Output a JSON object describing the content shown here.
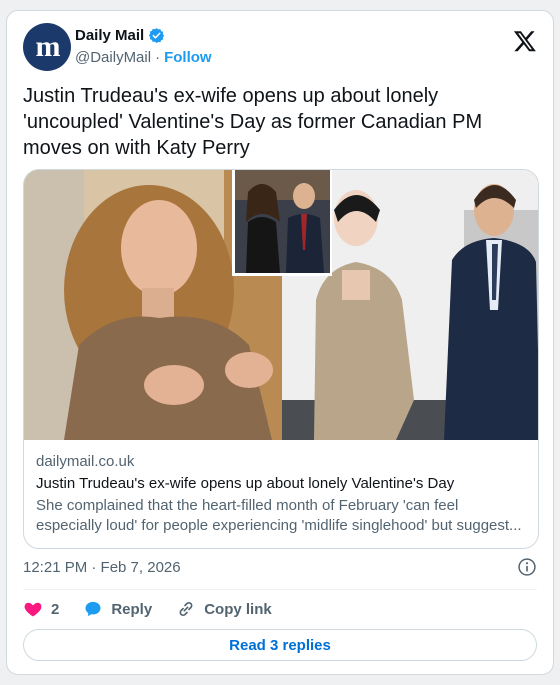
{
  "author": {
    "display_name": "Daily Mail",
    "handle": "@DailyMail",
    "separator": "·",
    "follow_label": "Follow",
    "avatar_text": "m",
    "verified": true
  },
  "tweet": {
    "text": "Justin Trudeau's ex-wife opens up about lonely 'uncoupled' Valentine's Day as former Canadian PM moves on with Katy Perry"
  },
  "link_card": {
    "domain": "dailymail.co.uk",
    "title": "Justin Trudeau's ex-wife opens up about lonely Valentine's Day",
    "description_line1": "She complained that the heart-filled month of February 'can feel",
    "description_line2": "especially loud' for people experiencing 'midlife singlehood' but suggest..."
  },
  "timestamp": "12:21 PM · Feb 7, 2026",
  "actions": {
    "like_count": "2",
    "reply_label": "Reply",
    "copy_link_label": "Copy link"
  },
  "read_replies_label": "Read 3 replies",
  "icons": {
    "verified": "verified-badge-icon",
    "brand": "x-logo-icon",
    "info": "info-icon",
    "like": "heart-icon",
    "reply": "speech-bubble-icon",
    "copy": "link-icon"
  },
  "colors": {
    "accent": "#1d9bf0",
    "link": "#006fd6",
    "like": "#f91880",
    "muted": "#536471",
    "avatar_bg": "#1b3a6b"
  }
}
